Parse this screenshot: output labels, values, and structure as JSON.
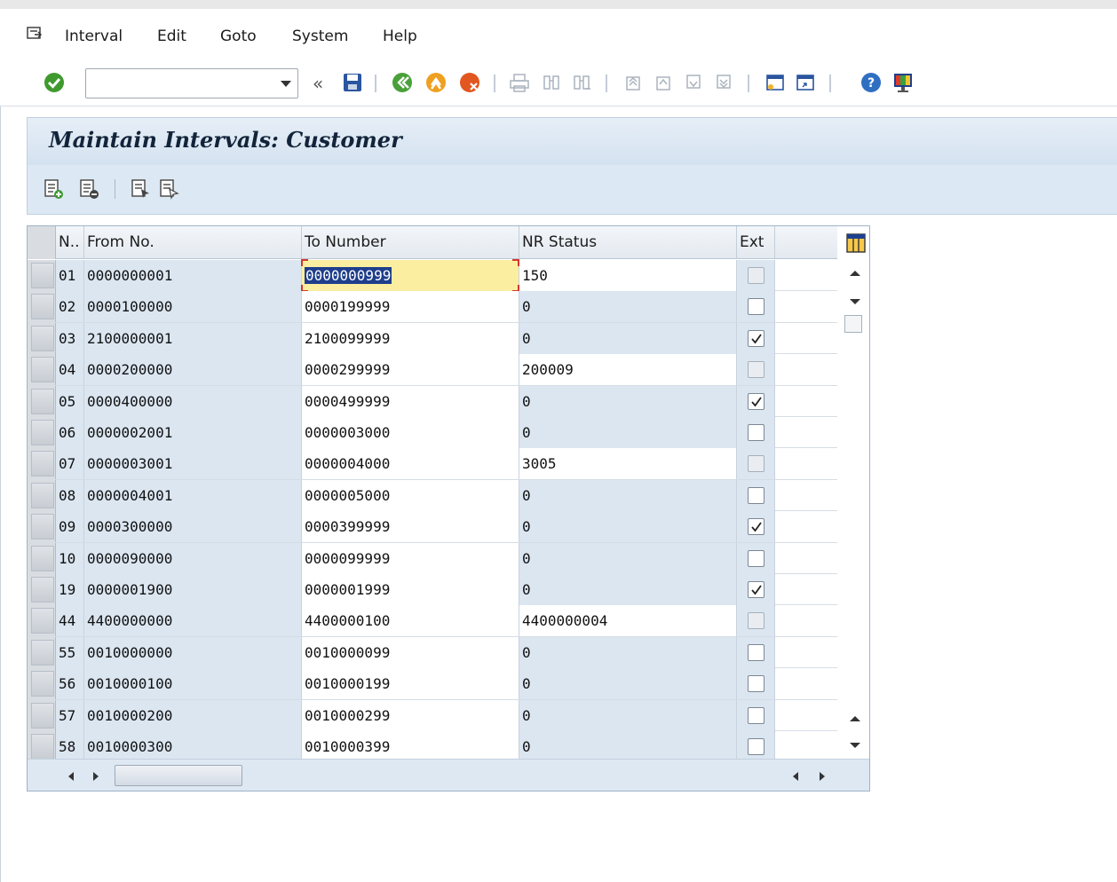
{
  "menu": {
    "items": [
      "Interval",
      "Edit",
      "Goto",
      "System",
      "Help"
    ]
  },
  "toolbar": {
    "command_value": "",
    "back_glyph": "«"
  },
  "page": {
    "title": "Maintain Intervals: Customer"
  },
  "table": {
    "headers": {
      "n": "N..",
      "from": "From No.",
      "to": "To Number",
      "nr": "NR Status",
      "ext": "Ext"
    },
    "rows": [
      {
        "n": "01",
        "from": "0000000001",
        "to": "0000000999",
        "nr": "150",
        "ext": false,
        "ext_enabled": false
      },
      {
        "n": "02",
        "from": "0000100000",
        "to": "0000199999",
        "nr": "0",
        "ext": false,
        "ext_enabled": true
      },
      {
        "n": "03",
        "from": "2100000001",
        "to": "2100099999",
        "nr": "0",
        "ext": true,
        "ext_enabled": true
      },
      {
        "n": "04",
        "from": "0000200000",
        "to": "0000299999",
        "nr": "200009",
        "ext": false,
        "ext_enabled": false
      },
      {
        "n": "05",
        "from": "0000400000",
        "to": "0000499999",
        "nr": "0",
        "ext": true,
        "ext_enabled": true
      },
      {
        "n": "06",
        "from": "0000002001",
        "to": "0000003000",
        "nr": "0",
        "ext": false,
        "ext_enabled": true
      },
      {
        "n": "07",
        "from": "0000003001",
        "to": "0000004000",
        "nr": "3005",
        "ext": false,
        "ext_enabled": false
      },
      {
        "n": "08",
        "from": "0000004001",
        "to": "0000005000",
        "nr": "0",
        "ext": false,
        "ext_enabled": true
      },
      {
        "n": "09",
        "from": "0000300000",
        "to": "0000399999",
        "nr": "0",
        "ext": true,
        "ext_enabled": true
      },
      {
        "n": "10",
        "from": "0000090000",
        "to": "0000099999",
        "nr": "0",
        "ext": false,
        "ext_enabled": true
      },
      {
        "n": "19",
        "from": "0000001900",
        "to": "0000001999",
        "nr": "0",
        "ext": true,
        "ext_enabled": true
      },
      {
        "n": "44",
        "from": "4400000000",
        "to": "4400000100",
        "nr": "4400000004",
        "ext": false,
        "ext_enabled": false
      },
      {
        "n": "55",
        "from": "0010000000",
        "to": "0010000099",
        "nr": "0",
        "ext": false,
        "ext_enabled": true
      },
      {
        "n": "56",
        "from": "0010000100",
        "to": "0010000199",
        "nr": "0",
        "ext": false,
        "ext_enabled": true
      },
      {
        "n": "57",
        "from": "0010000200",
        "to": "0010000299",
        "nr": "0",
        "ext": false,
        "ext_enabled": true
      },
      {
        "n": "58",
        "from": "0010000300",
        "to": "0010000399",
        "nr": "0",
        "ext": false,
        "ext_enabled": true
      }
    ],
    "focused_row": 0
  },
  "colors": {
    "title_bg": "#d4e2f0",
    "focus_cell": "#fbeea0",
    "selection": "#1f3e8c"
  }
}
